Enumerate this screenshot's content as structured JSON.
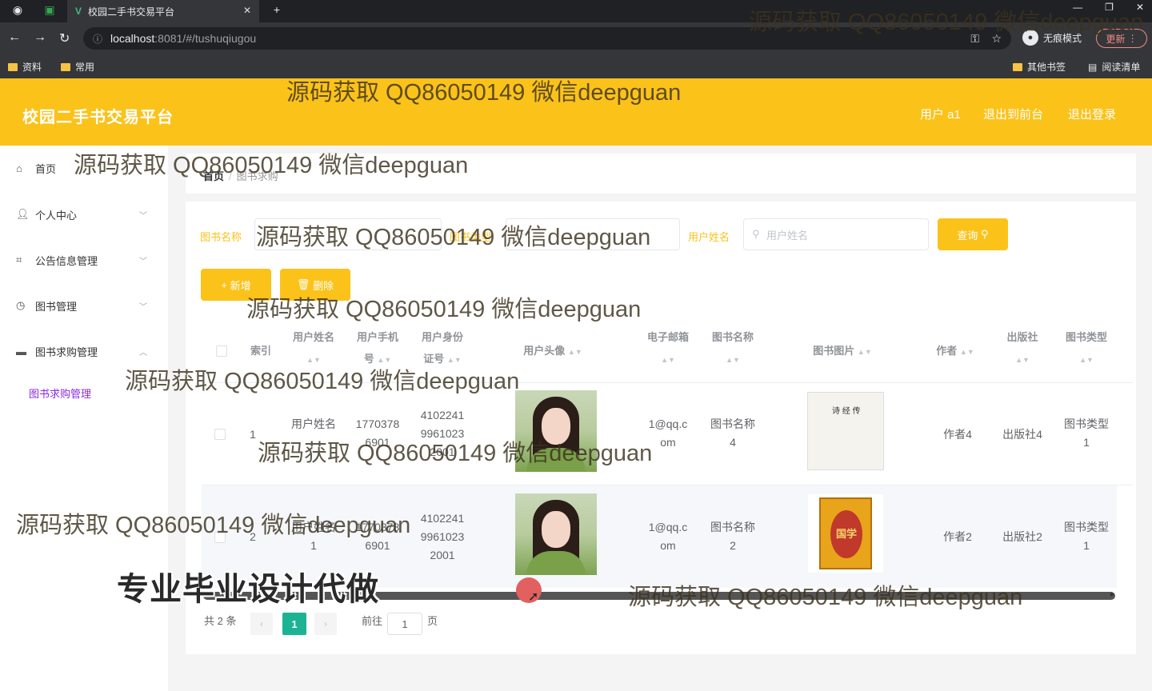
{
  "browser": {
    "tab_title": "校园二手书交易平台",
    "url_host": "localhost",
    "url_path": ":8081/#/tushuqiugou",
    "incognito_label": "无痕模式",
    "update_label": "更新",
    "bookmarks": [
      "资料",
      "常用"
    ],
    "other_bookmarks": "其他书签",
    "reading_list": "阅读清单"
  },
  "header": {
    "title": "校园二手书交易平台",
    "user": "用户 a1",
    "to_front": "退出到前台",
    "logout": "退出登录"
  },
  "sidebar": {
    "items": [
      {
        "label": "首页",
        "icon": "home-icon"
      },
      {
        "label": "个人中心",
        "icon": "user-icon"
      },
      {
        "label": "公告信息管理",
        "icon": "crop-icon"
      },
      {
        "label": "图书管理",
        "icon": "clock-icon"
      },
      {
        "label": "图书求购管理",
        "icon": "film-icon"
      }
    ],
    "sub_item": "图书求购管理"
  },
  "breadcrumb": {
    "home": "首页",
    "sep": "/",
    "current": "图书求购"
  },
  "filters": {
    "book_name_label": "图书名称",
    "book_type_label": "图书类型",
    "user_name_label": "用户姓名",
    "user_name_placeholder": "用户姓名",
    "search_button": "查询"
  },
  "actions": {
    "add": "新增",
    "delete": "删除"
  },
  "table": {
    "headers": {
      "index": "索引",
      "user_name": "用户姓名",
      "phone_1": "用户手机",
      "phone_2": "号",
      "id_1": "用户身份",
      "id_2": "证号",
      "avatar": "用户头像",
      "email": "电子邮箱",
      "book_name": "图书名称",
      "book_image": "图书图片",
      "author": "作者",
      "publisher": "出版社",
      "book_type": "图书类型"
    },
    "rows": [
      {
        "index": "1",
        "user_name": "用户姓名",
        "phone": [
          "1770378",
          "6901"
        ],
        "id": [
          "4102241",
          "9961023",
          "2001"
        ],
        "email": [
          "1@qq.c",
          "om"
        ],
        "book_name": [
          "图书名称",
          "4"
        ],
        "book_cover_text": "诗 经 传",
        "author": "作者4",
        "publisher": "出版社4",
        "book_type": [
          "图书类型",
          "1"
        ]
      },
      {
        "index": "2",
        "user_name": [
          "用户姓名",
          "1"
        ],
        "phone": [
          "1770378",
          "6901"
        ],
        "id": [
          "4102241",
          "9961023",
          "2001"
        ],
        "email": [
          "1@qq.c",
          "om"
        ],
        "book_name": [
          "图书名称",
          "2"
        ],
        "book_cover_text": "国学",
        "author": "作者2",
        "publisher": "出版社2",
        "book_type": [
          "图书类型",
          "1"
        ]
      }
    ]
  },
  "pagination": {
    "total": "共 2 条",
    "current_page": "1",
    "goto_label": "前往",
    "goto_value": "1",
    "page_suffix": "页"
  },
  "watermarks": {
    "text": "源码获取 QQ86050149 微信deepguan",
    "banner": "专业毕业设计代做"
  },
  "colors": {
    "accent": "#fbc21a",
    "pager_active": "#1bb394",
    "submenu": "#8a2be2"
  }
}
